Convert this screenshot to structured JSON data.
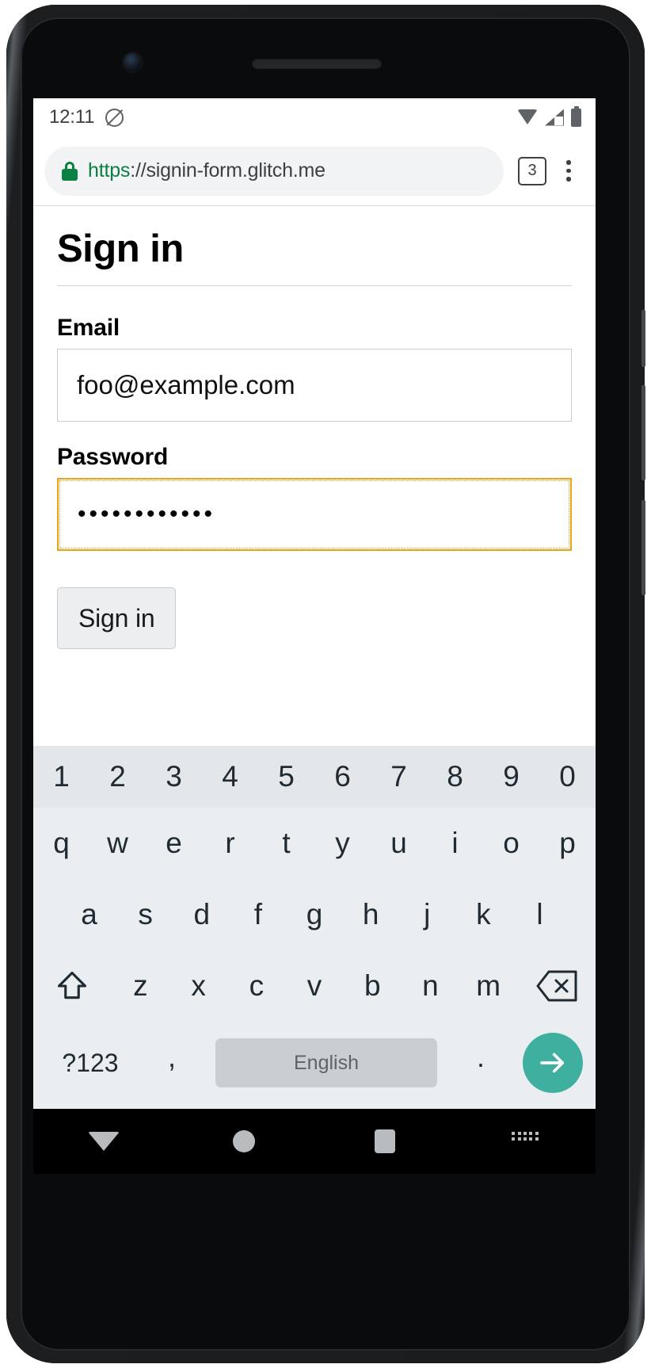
{
  "device": {
    "type": "android-phone-mockup",
    "camera": "front-camera",
    "speaker": "earpiece-speaker"
  },
  "status_bar": {
    "time": "12:11",
    "icons": [
      "rotation-lock-icon",
      "wifi-icon",
      "cell-signal-icon",
      "battery-icon"
    ]
  },
  "browser": {
    "security_icon": "lock-icon",
    "url_scheme": "https",
    "url_separator": "://",
    "url_host": "signin-form.glitch.me",
    "tab_count": "3",
    "menu_icon": "overflow-menu-icon"
  },
  "page": {
    "title": "Sign in",
    "fields": [
      {
        "label": "Email",
        "value": "foo@example.com",
        "type": "email",
        "focused": false
      },
      {
        "label": "Password",
        "value": "••••••••••••",
        "type": "password",
        "focused": true
      }
    ],
    "submit_label": "Sign in",
    "focus_color": "#e8a317"
  },
  "keyboard": {
    "numbers": [
      "1",
      "2",
      "3",
      "4",
      "5",
      "6",
      "7",
      "8",
      "9",
      "0"
    ],
    "row1": [
      "q",
      "w",
      "e",
      "r",
      "t",
      "y",
      "u",
      "i",
      "o",
      "p"
    ],
    "row2": [
      "a",
      "s",
      "d",
      "f",
      "g",
      "h",
      "j",
      "k",
      "l"
    ],
    "row3": [
      "z",
      "x",
      "c",
      "v",
      "b",
      "n",
      "m"
    ],
    "shift_icon": "shift-arrow-icon",
    "backspace_icon": "backspace-icon",
    "symbols_label": "?123",
    "comma": ",",
    "space_label": "English",
    "period": ".",
    "enter_icon": "arrow-right-icon",
    "enter_color": "#3fb0a0"
  },
  "nav_bar": {
    "back_icon": "dismiss-keyboard-down-arrow-icon",
    "home_icon": "home-circle-icon",
    "recents_icon": "recents-square-icon",
    "keyboard_switch_icon": "keyboard-switcher-icon"
  }
}
